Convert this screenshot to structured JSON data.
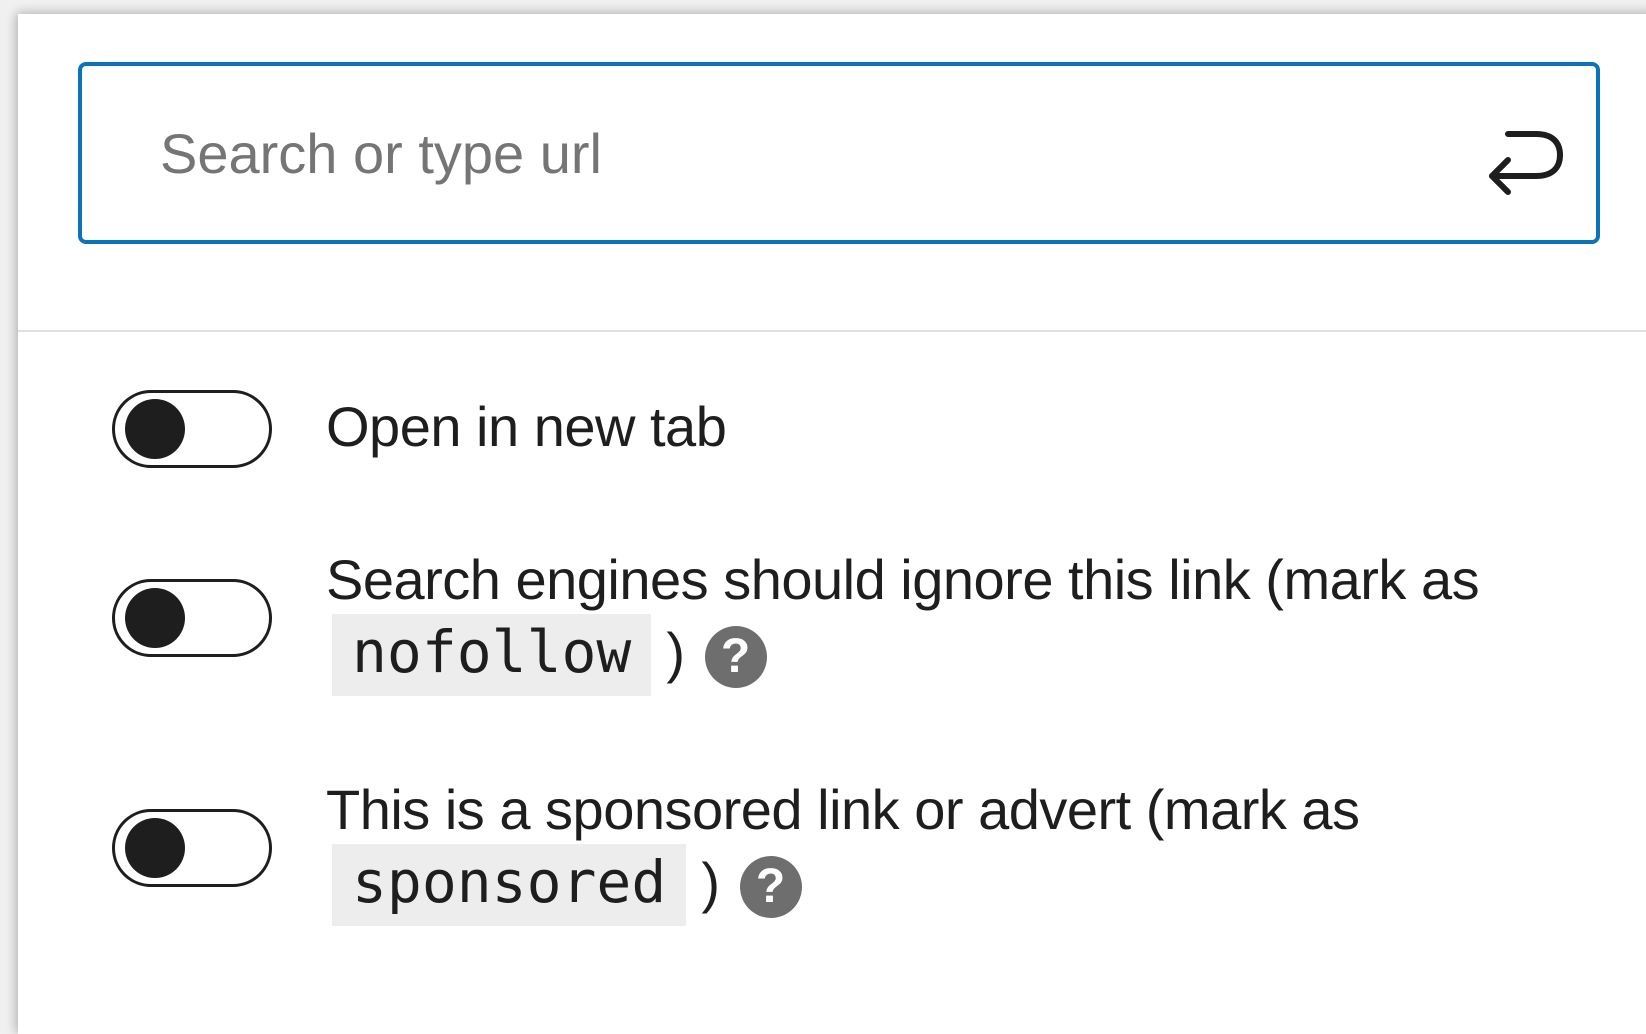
{
  "link_popover": {
    "search": {
      "placeholder": "Search or type url",
      "value": "",
      "submit_icon": "enter-return-icon"
    },
    "settings": [
      {
        "label": "Open in new tab",
        "enabled": false
      },
      {
        "label_prefix": "Search engines should ignore this link (mark as",
        "code": "nofollow",
        "label_suffix": ")",
        "help_icon": "?",
        "enabled": false
      },
      {
        "label_prefix": "This is a sponsored link or advert (mark as",
        "code": "sponsored",
        "label_suffix": ")",
        "help_icon": "?",
        "enabled": false
      }
    ]
  },
  "colors": {
    "focus_border": "#0a74b8",
    "text": "#1e1e1e",
    "placeholder": "#757575",
    "help_icon_bg": "#6e6e6e",
    "code_bg": "#ededed",
    "divider": "#e0e0e0"
  }
}
